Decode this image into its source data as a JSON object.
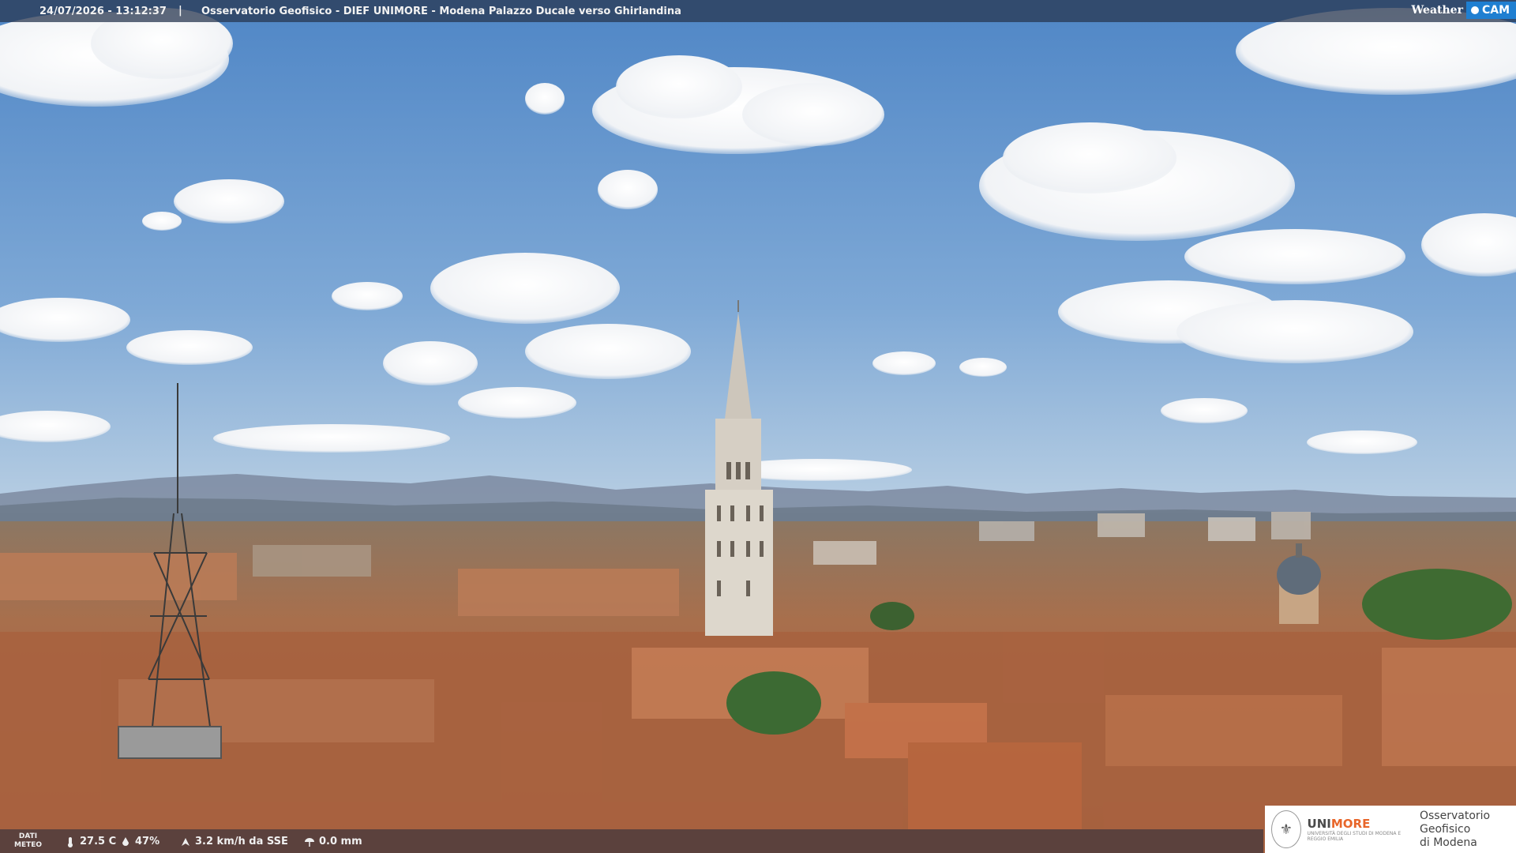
{
  "overlay": {
    "timestamp": "24/07/2026 - 13:12:37",
    "separator": "|",
    "title": "Osservatorio Geofisico - DIEF UNIMORE - Modena Palazzo Ducale verso Ghirlandina"
  },
  "brand": {
    "weather": "Weather",
    "cam": "CAM"
  },
  "weather_bar": {
    "label_line1": "DATI",
    "label_line2": "METEO",
    "temperature": "27.5 C",
    "humidity": "47%",
    "wind": "3.2 km/h da SSE",
    "rain": "0.0 mm"
  },
  "logo": {
    "unimore_a": "UNI",
    "unimore_b": "MORE",
    "unimore_sub": "UNIVERSITÀ DEGLI STUDI DI MODENA E REGGIO EMILIA",
    "obs_line1": "Osservatorio Geofisico",
    "obs_line2": "di Modena"
  },
  "colors": {
    "sky_top": "#4f86c6",
    "sky_bottom": "#a9c4df",
    "roof": "#b8795a",
    "tower": "#d9d2c6",
    "unimore_orange": "#e8662a",
    "weathercam_blue": "#1f7fd1"
  },
  "icons": [
    "thermometer-icon",
    "humidity-icon",
    "wind-icon",
    "rain-icon",
    "unimore-seal-icon"
  ]
}
